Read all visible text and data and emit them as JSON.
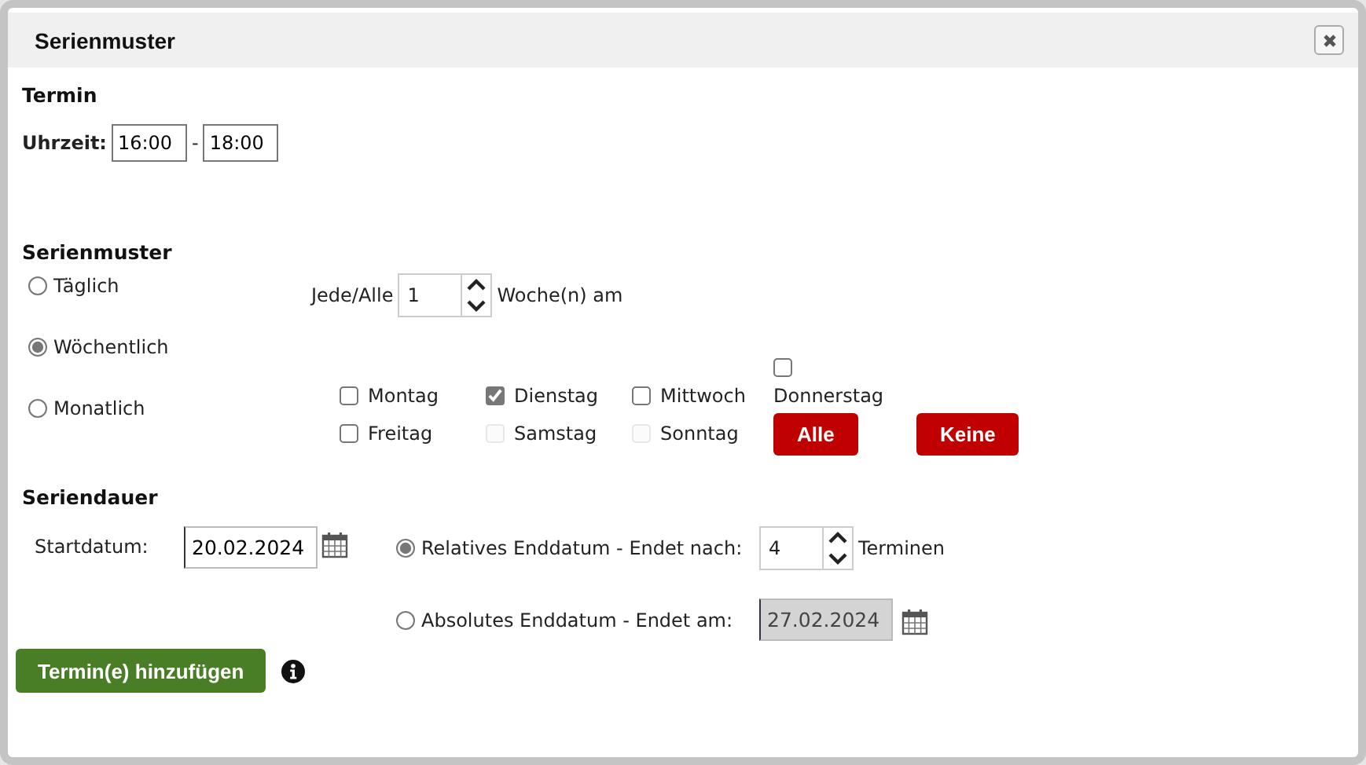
{
  "window": {
    "title": "Serienmuster"
  },
  "appointment": {
    "heading": "Termin",
    "time_label": "Uhrzeit:",
    "start": "16:00",
    "separator": "-",
    "end": "18:00"
  },
  "pattern": {
    "heading": "Serienmuster",
    "options": [
      {
        "label": "Täglich",
        "selected": false
      },
      {
        "label": "Wöchentlich",
        "selected": true
      },
      {
        "label": "Monatlich",
        "selected": false
      }
    ],
    "interval": {
      "prefix": "Jede/Alle",
      "value": "1",
      "suffix": "Woche(n) am"
    },
    "days": [
      {
        "label": "Montag",
        "checked": false,
        "disabled": false
      },
      {
        "label": "Dienstag",
        "checked": true,
        "disabled": false
      },
      {
        "label": "Mittwoch",
        "checked": false,
        "disabled": false
      },
      {
        "label": "Donnerstag",
        "checked": false,
        "disabled": false
      },
      {
        "label": "Freitag",
        "checked": false,
        "disabled": false
      },
      {
        "label": "Samstag",
        "checked": false,
        "disabled": true
      },
      {
        "label": "Sonntag",
        "checked": false,
        "disabled": true
      }
    ],
    "buttons": [
      "Alle",
      "Keine"
    ]
  },
  "duration": {
    "heading": "Seriendauer",
    "start_label": "Startdatum:",
    "start_value": "20.02.2024",
    "end_options": [
      {
        "kind": "relative",
        "label": "Relatives Enddatum - Endet nach:",
        "selected": true,
        "value": "4",
        "suffix": "Terminen"
      },
      {
        "kind": "absolute",
        "label": "Absolutes Enddatum - Endet am:",
        "selected": false,
        "value": "27.02.2024",
        "disabled": true
      }
    ]
  },
  "submit_button": "Termin(e) hinzufügen"
}
